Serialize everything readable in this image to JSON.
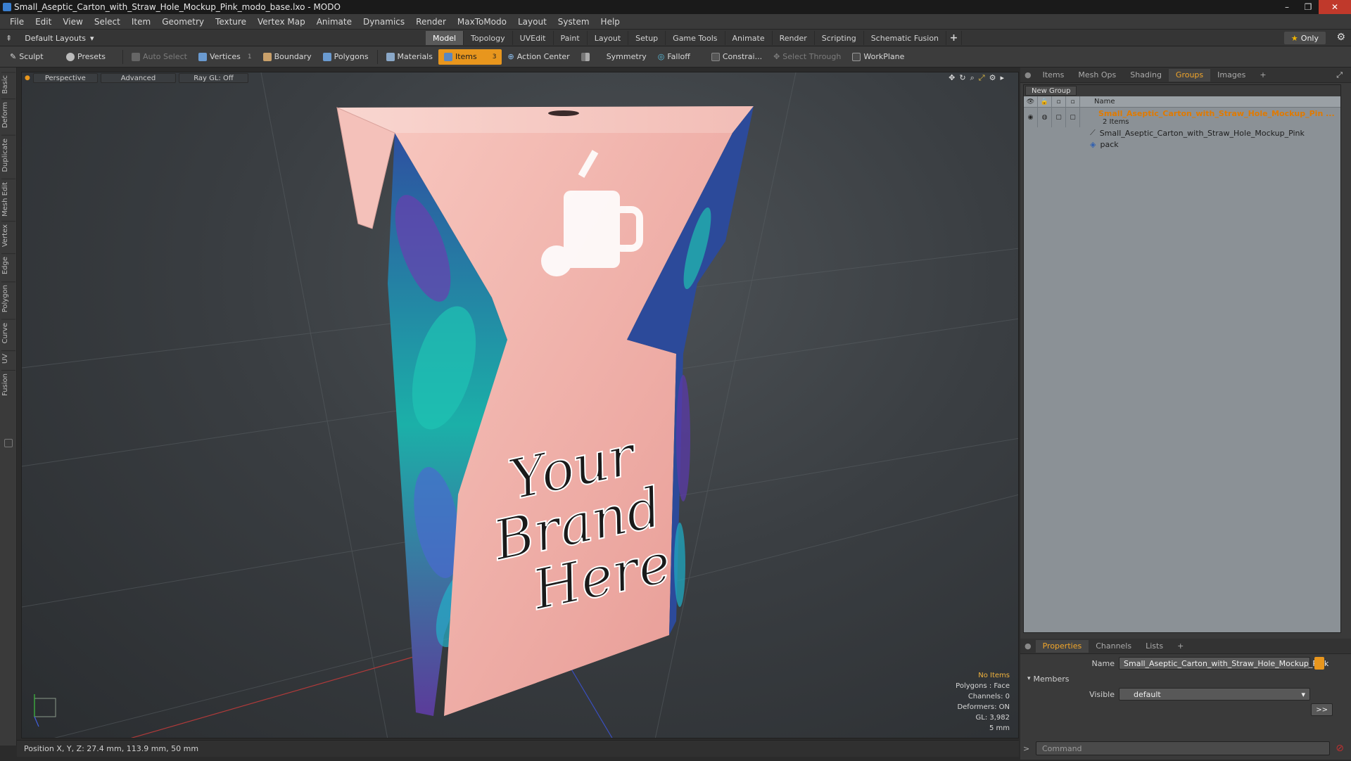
{
  "window": {
    "title": "Small_Aseptic_Carton_with_Straw_Hole_Mockup_Pink_modo_base.lxo - MODO",
    "controls": [
      "–",
      "❐",
      "✕"
    ]
  },
  "menubar": [
    "File",
    "Edit",
    "View",
    "Select",
    "Item",
    "Geometry",
    "Texture",
    "Vertex Map",
    "Animate",
    "Dynamics",
    "Render",
    "MaxToModo",
    "Layout",
    "System",
    "Help"
  ],
  "layoutbar": {
    "layout_select": "Default Layouts",
    "tabs": [
      "Model",
      "Topology",
      "UVEdit",
      "Paint",
      "Layout",
      "Setup",
      "Game Tools",
      "Animate",
      "Render",
      "Scripting",
      "Schematic Fusion"
    ],
    "active_tab": "Model",
    "add_label": "+",
    "only_label": "Only"
  },
  "toolbar": {
    "sculpt": "Sculpt",
    "presets": "Presets",
    "auto_select": "Auto Select",
    "vertices": "Vertices",
    "vertices_count": "1",
    "boundary": "Boundary",
    "polygons": "Polygons",
    "materials": "Materials",
    "items": "Items",
    "items_count": "3",
    "action_center": "Action Center",
    "symmetry": "Symmetry",
    "falloff": "Falloff",
    "constraints": "Constrai...",
    "select_through": "Select Through",
    "workplane": "WorkPlane"
  },
  "lefttabs": [
    "Basic",
    "Deform",
    "Duplicate",
    "Mesh Edit",
    "Vertex",
    "Edge",
    "Polygon",
    "Curve",
    "UV",
    "Fusion"
  ],
  "viewport": {
    "view_mode": "Perspective",
    "shading": "Advanced",
    "raygl": "Ray GL: Off",
    "carton_text": [
      "Your",
      "Brand",
      "Here"
    ],
    "info": {
      "items": "No Items",
      "polygons": "Polygons : Face",
      "channels": "Channels: 0",
      "deformers": "Deformers: ON",
      "gl": "GL: 3,982",
      "scale": "5 mm"
    }
  },
  "statusbar": {
    "position": "Position X, Y, Z:  27.4 mm, 113.9 mm, 50 mm"
  },
  "rightpanel": {
    "top_tabs": [
      "Items",
      "Mesh Ops",
      "Shading",
      "Groups",
      "Images"
    ],
    "active_top_tab": "Groups",
    "add_tab": "+",
    "new_group": "New Group",
    "name_header": "Name",
    "group_name": "Small_Aseptic_Carton_with_Straw_Hole_Mockup_Pin ...",
    "group_count": "2 Items",
    "children": [
      "Small_Aseptic_Carton_with_Straw_Hole_Mockup_Pink",
      "pack"
    ],
    "bottom_tabs": [
      "Properties",
      "Channels",
      "Lists"
    ],
    "active_bottom_tab": "Properties",
    "name_label": "Name",
    "name_value": "Small_Aseptic_Carton_with_Straw_Hole_Mockup_Pink",
    "members_label": "Members",
    "visible_label": "Visible",
    "visible_value": "default",
    "arrow_btn": ">>",
    "command_placeholder": "Command"
  },
  "colors": {
    "accent": "#e8961d",
    "group_text": "#e07a00",
    "carton_pink": "#f3b8b2"
  }
}
